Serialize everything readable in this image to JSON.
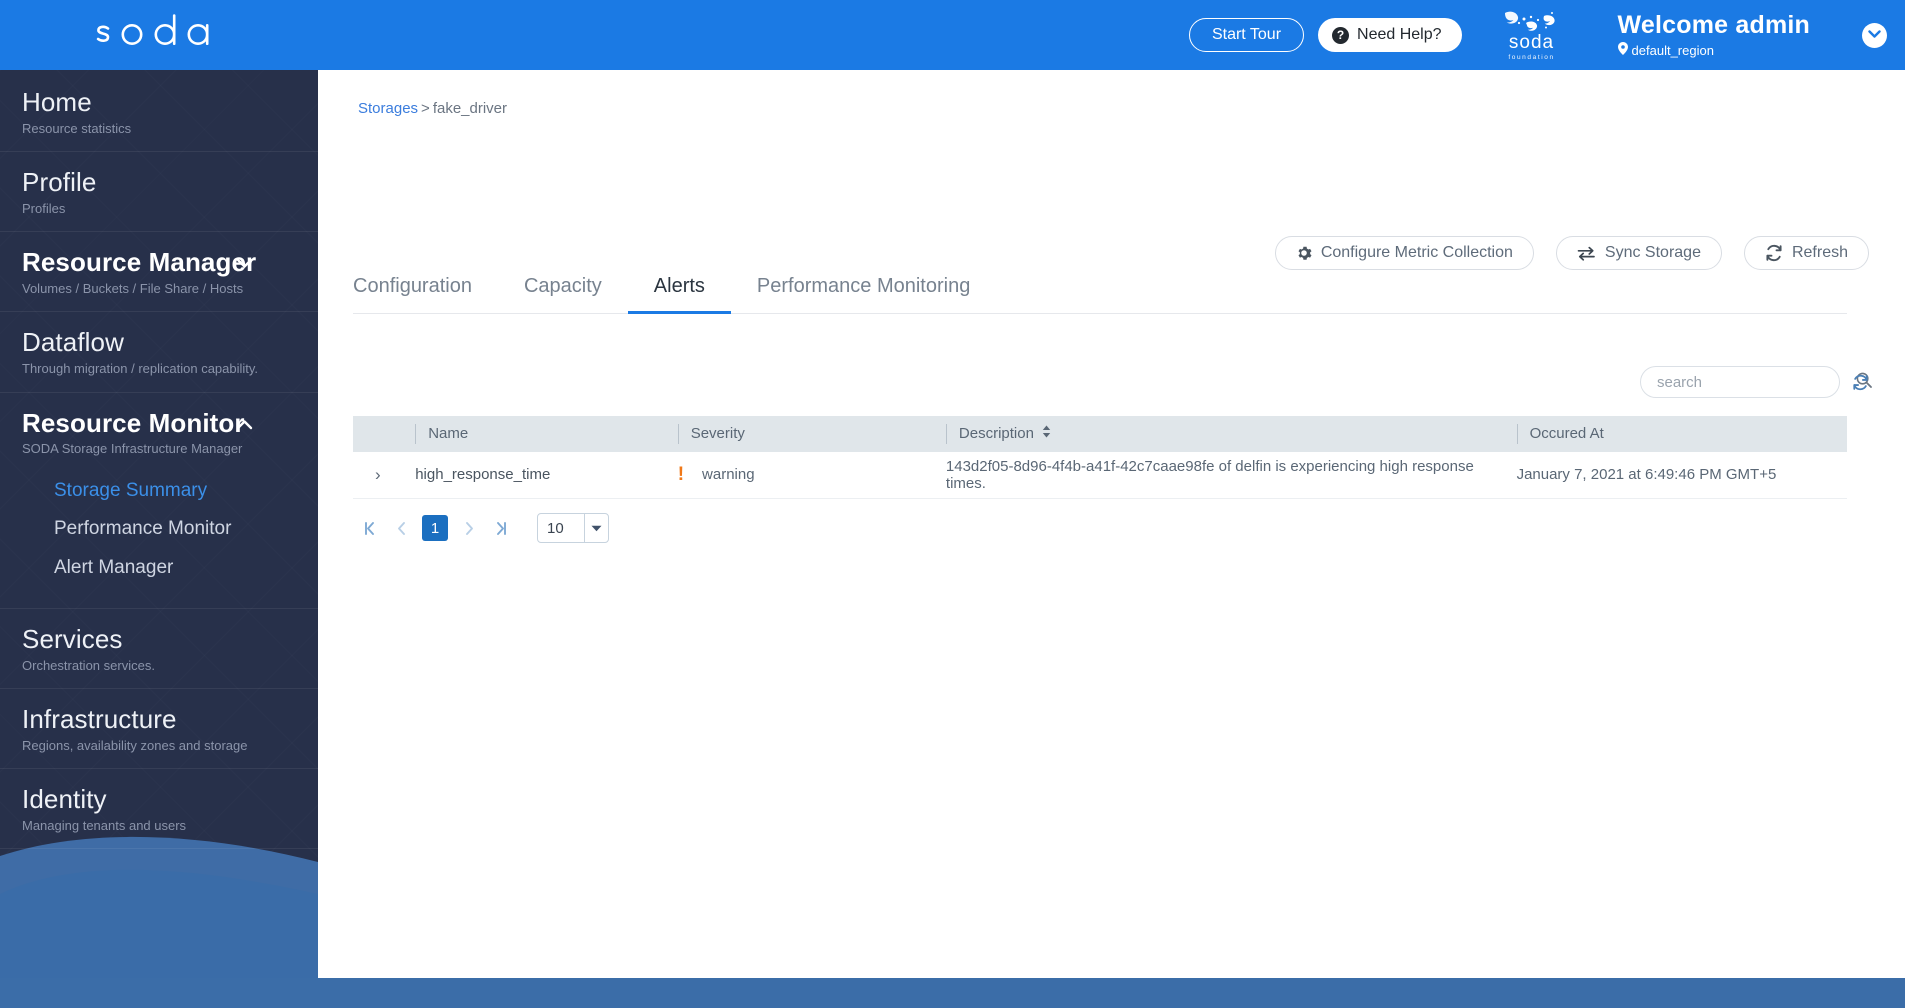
{
  "header": {
    "logo_text": "soda",
    "start_tour_label": "Start Tour",
    "need_help_label": "Need Help?",
    "help_icon": "question-mark-icon",
    "foundation_word": "soda",
    "foundation_sub": "foundation",
    "welcome_text": "Welcome admin",
    "region": "default_region",
    "region_icon": "location-pin-icon",
    "account_chevron_icon": "chevron-down-icon",
    "brand_color": "#1b7ae4"
  },
  "sidebar": {
    "groups": [
      {
        "title": "Home",
        "subtitle": "Resource statistics",
        "bold": false,
        "caret": null,
        "children": []
      },
      {
        "title": "Profile",
        "subtitle": "Profiles",
        "bold": false,
        "caret": null,
        "children": []
      },
      {
        "title": "Resource Manager",
        "subtitle": "Volumes / Buckets / File Share / Hosts",
        "bold": true,
        "caret": "chevron-down-icon",
        "children": []
      },
      {
        "title": "Dataflow",
        "subtitle": "Through migration / replication capability.",
        "bold": false,
        "caret": null,
        "children": []
      },
      {
        "title": "Resource Monitor",
        "subtitle": "SODA Storage Infrastructure Manager",
        "bold": true,
        "caret": "chevron-up-icon",
        "children": [
          {
            "label": "Storage Summary",
            "active": true
          },
          {
            "label": "Performance Monitor",
            "active": false
          },
          {
            "label": "Alert Manager",
            "active": false
          }
        ]
      },
      {
        "title": "Services",
        "subtitle": "Orchestration services.",
        "bold": false,
        "caret": null,
        "children": []
      },
      {
        "title": "Infrastructure",
        "subtitle": "Regions, availability zones and storage",
        "bold": false,
        "caret": null,
        "children": []
      },
      {
        "title": "Identity",
        "subtitle": "Managing tenants and users",
        "bold": false,
        "caret": null,
        "children": []
      }
    ],
    "active_color": "#3b8fe8",
    "background_color": "#27304a"
  },
  "breadcrumb": {
    "root": "Storages",
    "separator": ">",
    "current": "fake_driver"
  },
  "actions": [
    {
      "label": "Configure Metric Collection",
      "icon": "gear-icon"
    },
    {
      "label": "Sync Storage",
      "icon": "sync-arrows-icon"
    },
    {
      "label": "Refresh",
      "icon": "refresh-icon"
    }
  ],
  "tabs": [
    {
      "label": "Configuration",
      "active": false
    },
    {
      "label": "Capacity",
      "active": false
    },
    {
      "label": "Alerts",
      "active": true
    },
    {
      "label": "Performance Monitoring",
      "active": false
    }
  ],
  "search": {
    "placeholder": "search",
    "value": "",
    "icon": "search-icon",
    "refresh_icon": "refresh-icon"
  },
  "table": {
    "columns": [
      {
        "label": "",
        "key": "expand",
        "sortable": false
      },
      {
        "label": "Name",
        "key": "name",
        "sortable": false
      },
      {
        "label": "Severity",
        "key": "severity",
        "sortable": false
      },
      {
        "label": "Description",
        "key": "description",
        "sortable": true,
        "sort_icon": "sort-updown-icon"
      },
      {
        "label": "Occured At",
        "key": "occured_at",
        "sortable": false
      }
    ],
    "rows": [
      {
        "expand_icon": "chevron-right-icon",
        "name": "high_response_time",
        "severity_icon": "exclamation-icon",
        "severity": "warning",
        "severity_color": "#f07818",
        "description": "143d2f05-8d96-4f4b-a41f-42c7caae98fe of delfin is experiencing high response times.",
        "occured_at": "January 7, 2021 at 6:49:46 PM GMT+5"
      }
    ]
  },
  "pagination": {
    "first_icon": "page-first-icon",
    "prev_icon": "chevron-left-icon",
    "pages": [
      "1"
    ],
    "current_page": "1",
    "next_icon": "chevron-right-icon",
    "last_icon": "page-last-icon",
    "page_size": "10",
    "page_size_caret": "caret-down-icon"
  },
  "footer": {
    "color": "#3b6da8"
  }
}
